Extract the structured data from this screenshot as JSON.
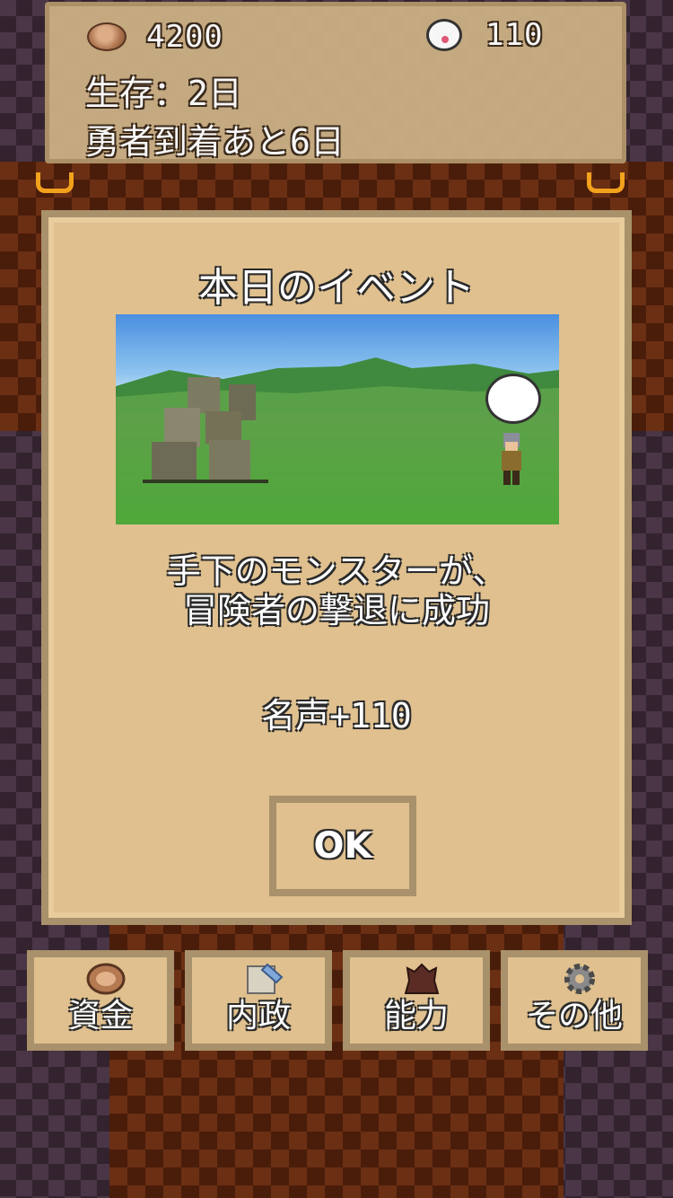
{
  "status": {
    "funds_icon": "coin-icon",
    "funds": "4200",
    "fame_icon": "fame-bubble-icon",
    "fame": "110",
    "survival": "生存：2日",
    "hero_arrival": "勇者到着あと6日"
  },
  "event": {
    "title": "本日のイベント",
    "scene": "golem-vs-adventurer-grassland",
    "message": "手下のモンスターが、\n冒険者の撃退に成功",
    "reward": "名声+110",
    "ok_label": "OK"
  },
  "menu": {
    "items": [
      {
        "label": "資金",
        "icon": "coin-icon"
      },
      {
        "label": "内政",
        "icon": "scroll-icon"
      },
      {
        "label": "能力",
        "icon": "demon-icon"
      },
      {
        "label": "その他",
        "icon": "gear-icon"
      }
    ]
  },
  "colors": {
    "panel": "#dfc08e",
    "panel_border": "#a8916b",
    "text_outline": "#2a2a2a"
  }
}
